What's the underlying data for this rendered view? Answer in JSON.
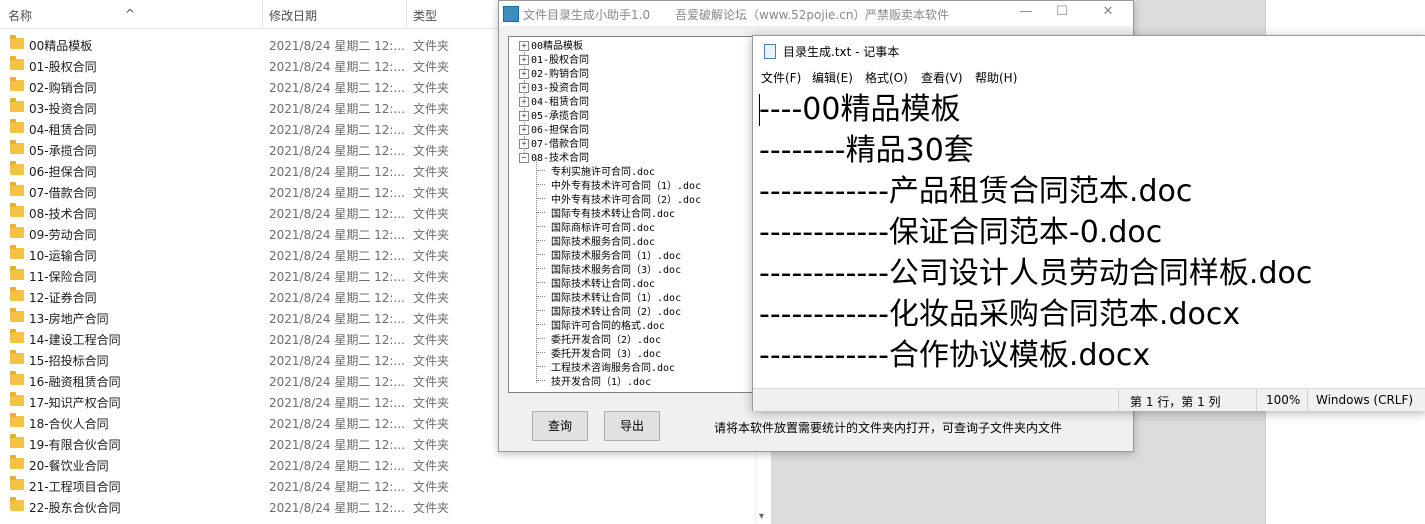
{
  "explorer": {
    "columns": {
      "name": "名称",
      "date": "修改日期",
      "type": "类型"
    },
    "rows": [
      {
        "name": "00精品模板",
        "date": "2021/8/24 星期二 12:...",
        "type": "文件夹"
      },
      {
        "name": "01-股权合同",
        "date": "2021/8/24 星期二 12:...",
        "type": "文件夹"
      },
      {
        "name": "02-购销合同",
        "date": "2021/8/24 星期二 12:...",
        "type": "文件夹"
      },
      {
        "name": "03-投资合同",
        "date": "2021/8/24 星期二 12:...",
        "type": "文件夹"
      },
      {
        "name": "04-租赁合同",
        "date": "2021/8/24 星期二 12:...",
        "type": "文件夹"
      },
      {
        "name": "05-承揽合同",
        "date": "2021/8/24 星期二 12:...",
        "type": "文件夹"
      },
      {
        "name": "06-担保合同",
        "date": "2021/8/24 星期二 12:...",
        "type": "文件夹"
      },
      {
        "name": "07-借款合同",
        "date": "2021/8/24 星期二 12:...",
        "type": "文件夹"
      },
      {
        "name": "08-技术合同",
        "date": "2021/8/24 星期二 12:...",
        "type": "文件夹"
      },
      {
        "name": "09-劳动合同",
        "date": "2021/8/24 星期二 12:...",
        "type": "文件夹"
      },
      {
        "name": "10-运输合同",
        "date": "2021/8/24 星期二 12:...",
        "type": "文件夹"
      },
      {
        "name": "11-保险合同",
        "date": "2021/8/24 星期二 12:...",
        "type": "文件夹"
      },
      {
        "name": "12-证券合同",
        "date": "2021/8/24 星期二 12:...",
        "type": "文件夹"
      },
      {
        "name": "13-房地产合同",
        "date": "2021/8/24 星期二 12:...",
        "type": "文件夹"
      },
      {
        "name": "14-建设工程合同",
        "date": "2021/8/24 星期二 12:...",
        "type": "文件夹"
      },
      {
        "name": "15-招投标合同",
        "date": "2021/8/24 星期二 12:...",
        "type": "文件夹"
      },
      {
        "name": "16-融资租赁合同",
        "date": "2021/8/24 星期二 12:...",
        "type": "文件夹"
      },
      {
        "name": "17-知识产权合同",
        "date": "2021/8/24 星期二 12:...",
        "type": "文件夹"
      },
      {
        "name": "18-合伙人合同",
        "date": "2021/8/24 星期二 12:...",
        "type": "文件夹"
      },
      {
        "name": "19-有限合伙合同",
        "date": "2021/8/24 星期二 12:...",
        "type": "文件夹"
      },
      {
        "name": "20-餐饮业合同",
        "date": "2021/8/24 星期二 12:...",
        "type": "文件夹"
      },
      {
        "name": "21-工程项目合同",
        "date": "2021/8/24 星期二 12:...",
        "type": "文件夹"
      },
      {
        "name": "22-股东合伙合同",
        "date": "2021/8/24 星期二 12:...",
        "type": "文件夹"
      }
    ]
  },
  "tool": {
    "title": "文件目录生成小助手1.0",
    "forum": "吾爱破解论坛（www.52pojie.cn）",
    "warning": "严禁贩卖本软件",
    "tree_folders": [
      "00精品模板",
      "01-股权合同",
      "02-购销合同",
      "03-投资合同",
      "04-租赁合同",
      "05-承揽合同",
      "06-担保合同",
      "07-借款合同",
      "08-技术合同"
    ],
    "tree_files": [
      "专利实施许可合同.doc",
      "中外专有技术许可合同（1）.doc",
      "中外专有技术许可合同（2）.doc",
      "国际专有技术转让合同.doc",
      "国际商标许可合同.doc",
      "国际技术服务合同.doc",
      "国际技术服务合同（1）.doc",
      "国际技术服务合同（3）.doc",
      "国际技术转让合同.doc",
      "国际技术转让合同（1）.doc",
      "国际技术转让合同（2）.doc",
      "国际许可合同的格式.doc",
      "委托开发合同（2）.doc",
      "委托开发合同（3）.doc",
      "工程技术咨询服务合同.doc",
      "技开发合同（1）.doc"
    ],
    "query_label": "查询",
    "export_label": "导出",
    "hint": "请将本软件放置需要统计的文件夹内打开，可查询子文件夹内文件"
  },
  "notepad": {
    "title": "目录生成.txt - 记事本",
    "menu": [
      "文件(F)",
      "编辑(E)",
      "格式(O)",
      "查看(V)",
      "帮助(H)"
    ],
    "lines": [
      "----00精品模板",
      "--------精品30套",
      "------------产品租赁合同范本.doc",
      "------------保证合同范本-0.doc",
      "------------公司设计人员劳动合同样板.doc",
      "------------化妆品采购合同范本.docx",
      "------------合作协议模板.docx"
    ],
    "status": {
      "position": "第 1 行，第 1 列",
      "zoom": "100%",
      "encoding": "Windows (CRLF)"
    }
  }
}
